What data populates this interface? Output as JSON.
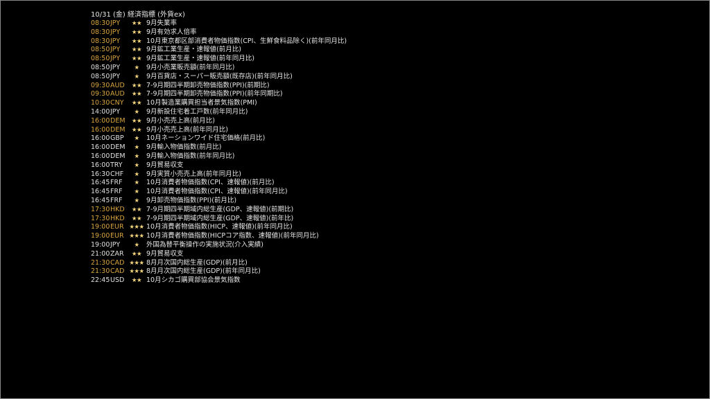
{
  "header": {
    "title": "10/31 (金) 経済指標 (外貨ex)"
  },
  "colors": {
    "background": "#000000",
    "text": "#e6e6e6",
    "highlight": "#d9a63f",
    "stars": "#f1d37a",
    "frame": "#8a8a8a"
  },
  "events": [
    {
      "time": "08:30",
      "ccy": "JPY",
      "stars": "★★",
      "name": "9月失業率",
      "highlight": true
    },
    {
      "time": "08:30",
      "ccy": "JPY",
      "stars": "★★",
      "name": "9月有効求人倍率",
      "highlight": true
    },
    {
      "time": "08:30",
      "ccy": "JPY",
      "stars": "★★",
      "name": "10月東京都区部消費者物価指数(CPI、生鮮食料品除く)(前年同月比)",
      "highlight": true
    },
    {
      "time": "08:50",
      "ccy": "JPY",
      "stars": "★★",
      "name": "9月鉱工業生産・速報値(前月比)",
      "highlight": true
    },
    {
      "time": "08:50",
      "ccy": "JPY",
      "stars": "★★",
      "name": "9月鉱工業生産・速報値(前年同月比)",
      "highlight": true
    },
    {
      "time": "08:50",
      "ccy": "JPY",
      "stars": "★",
      "name": "9月小売業販売額(前年同月比)",
      "highlight": false
    },
    {
      "time": "08:50",
      "ccy": "JPY",
      "stars": "★",
      "name": "9月百貨店・スーパー販売額(既存店)(前年同月比)",
      "highlight": false
    },
    {
      "time": "09:30",
      "ccy": "AUD",
      "stars": "★★",
      "name": "7-9月期四半期卸売物価指数(PPI)(前期比)",
      "highlight": true
    },
    {
      "time": "09:30",
      "ccy": "AUD",
      "stars": "★★",
      "name": "7-9月期四半期卸売物価指数(PPI)(前年同期比)",
      "highlight": true
    },
    {
      "time": "10:30",
      "ccy": "CNY",
      "stars": "★★",
      "name": "10月製造業購買担当者景気指数(PMI)",
      "highlight": true
    },
    {
      "time": "14:00",
      "ccy": "JPY",
      "stars": "★",
      "name": "9月新設住宅着工戸数(前年同月比)",
      "highlight": false
    },
    {
      "time": "16:00",
      "ccy": "DEM",
      "stars": "★★",
      "name": "9月小売売上高(前月比)",
      "highlight": true
    },
    {
      "time": "16:00",
      "ccy": "DEM",
      "stars": "★★",
      "name": "9月小売売上高(前年同月比)",
      "highlight": true
    },
    {
      "time": "16:00",
      "ccy": "GBP",
      "stars": "★",
      "name": "10月ネーションワイド住宅価格(前月比)",
      "highlight": false
    },
    {
      "time": "16:00",
      "ccy": "DEM",
      "stars": "★",
      "name": "9月輸入物価指数(前月比)",
      "highlight": false
    },
    {
      "time": "16:00",
      "ccy": "DEM",
      "stars": "★",
      "name": "9月輸入物価指数(前年同月比)",
      "highlight": false
    },
    {
      "time": "16:00",
      "ccy": "TRY",
      "stars": "★",
      "name": "9月貿易収支",
      "highlight": false
    },
    {
      "time": "16:30",
      "ccy": "CHF",
      "stars": "★",
      "name": "9月実質小売売上高(前年同月比)",
      "highlight": false
    },
    {
      "time": "16:45",
      "ccy": "FRF",
      "stars": "★",
      "name": "10月消費者物価指数(CPI、速報値)(前月比)",
      "highlight": false
    },
    {
      "time": "16:45",
      "ccy": "FRF",
      "stars": "★",
      "name": "10月消費者物価指数(CPI、速報値)(前年同月比)",
      "highlight": false
    },
    {
      "time": "16:45",
      "ccy": "FRF",
      "stars": "★",
      "name": "9月卸売物価指数(PPI)(前月比)",
      "highlight": false
    },
    {
      "time": "17:30",
      "ccy": "HKD",
      "stars": "★★",
      "name": "7-9月期四半期域内総生産(GDP、速報値)(前期比)",
      "highlight": true
    },
    {
      "time": "17:30",
      "ccy": "HKD",
      "stars": "★★",
      "name": "7-9月期四半期域内総生産(GDP、速報値)(前年比)",
      "highlight": true
    },
    {
      "time": "19:00",
      "ccy": "EUR",
      "stars": "★★★",
      "name": "10月消費者物価指数(HICP、速報値)(前年同月比)",
      "highlight": true
    },
    {
      "time": "19:00",
      "ccy": "EUR",
      "stars": "★★★",
      "name": "10月消費者物価指数(HICPコア指数、速報値)(前年同月比)",
      "highlight": true
    },
    {
      "time": "19:00",
      "ccy": "JPY",
      "stars": "★",
      "name": "外国為替平衡操作の実施状況(介入実績)",
      "highlight": false
    },
    {
      "time": "21:00",
      "ccy": "ZAR",
      "stars": "★★",
      "name": "9月貿易収支",
      "highlight": false
    },
    {
      "time": "21:30",
      "ccy": "CAD",
      "stars": "★★★",
      "name": "8月月次国内総生産(GDP)(前月比)",
      "highlight": true
    },
    {
      "time": "21:30",
      "ccy": "CAD",
      "stars": "★★★",
      "name": "8月月次国内総生産(GDP)(前年同月比)",
      "highlight": true
    },
    {
      "time": "22:45",
      "ccy": "USD",
      "stars": "★★",
      "name": "10月シカゴ購買部協会景気指数",
      "highlight": false
    }
  ]
}
